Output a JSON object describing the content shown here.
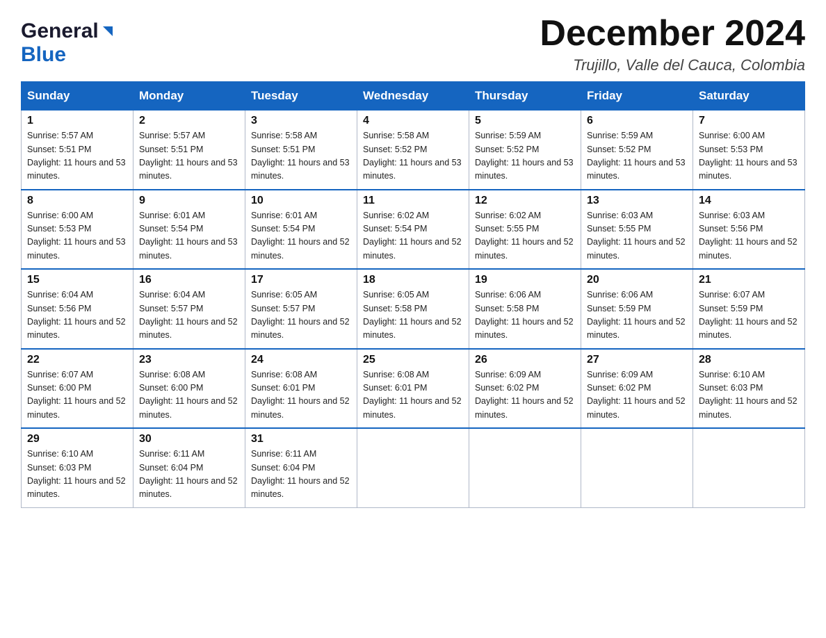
{
  "header": {
    "logo_general": "General",
    "logo_blue": "Blue",
    "month_title": "December 2024",
    "location": "Trujillo, Valle del Cauca, Colombia"
  },
  "weekdays": [
    "Sunday",
    "Monday",
    "Tuesday",
    "Wednesday",
    "Thursday",
    "Friday",
    "Saturday"
  ],
  "weeks": [
    [
      {
        "day": "1",
        "sunrise": "Sunrise: 5:57 AM",
        "sunset": "Sunset: 5:51 PM",
        "daylight": "Daylight: 11 hours and 53 minutes."
      },
      {
        "day": "2",
        "sunrise": "Sunrise: 5:57 AM",
        "sunset": "Sunset: 5:51 PM",
        "daylight": "Daylight: 11 hours and 53 minutes."
      },
      {
        "day": "3",
        "sunrise": "Sunrise: 5:58 AM",
        "sunset": "Sunset: 5:51 PM",
        "daylight": "Daylight: 11 hours and 53 minutes."
      },
      {
        "day": "4",
        "sunrise": "Sunrise: 5:58 AM",
        "sunset": "Sunset: 5:52 PM",
        "daylight": "Daylight: 11 hours and 53 minutes."
      },
      {
        "day": "5",
        "sunrise": "Sunrise: 5:59 AM",
        "sunset": "Sunset: 5:52 PM",
        "daylight": "Daylight: 11 hours and 53 minutes."
      },
      {
        "day": "6",
        "sunrise": "Sunrise: 5:59 AM",
        "sunset": "Sunset: 5:52 PM",
        "daylight": "Daylight: 11 hours and 53 minutes."
      },
      {
        "day": "7",
        "sunrise": "Sunrise: 6:00 AM",
        "sunset": "Sunset: 5:53 PM",
        "daylight": "Daylight: 11 hours and 53 minutes."
      }
    ],
    [
      {
        "day": "8",
        "sunrise": "Sunrise: 6:00 AM",
        "sunset": "Sunset: 5:53 PM",
        "daylight": "Daylight: 11 hours and 53 minutes."
      },
      {
        "day": "9",
        "sunrise": "Sunrise: 6:01 AM",
        "sunset": "Sunset: 5:54 PM",
        "daylight": "Daylight: 11 hours and 53 minutes."
      },
      {
        "day": "10",
        "sunrise": "Sunrise: 6:01 AM",
        "sunset": "Sunset: 5:54 PM",
        "daylight": "Daylight: 11 hours and 52 minutes."
      },
      {
        "day": "11",
        "sunrise": "Sunrise: 6:02 AM",
        "sunset": "Sunset: 5:54 PM",
        "daylight": "Daylight: 11 hours and 52 minutes."
      },
      {
        "day": "12",
        "sunrise": "Sunrise: 6:02 AM",
        "sunset": "Sunset: 5:55 PM",
        "daylight": "Daylight: 11 hours and 52 minutes."
      },
      {
        "day": "13",
        "sunrise": "Sunrise: 6:03 AM",
        "sunset": "Sunset: 5:55 PM",
        "daylight": "Daylight: 11 hours and 52 minutes."
      },
      {
        "day": "14",
        "sunrise": "Sunrise: 6:03 AM",
        "sunset": "Sunset: 5:56 PM",
        "daylight": "Daylight: 11 hours and 52 minutes."
      }
    ],
    [
      {
        "day": "15",
        "sunrise": "Sunrise: 6:04 AM",
        "sunset": "Sunset: 5:56 PM",
        "daylight": "Daylight: 11 hours and 52 minutes."
      },
      {
        "day": "16",
        "sunrise": "Sunrise: 6:04 AM",
        "sunset": "Sunset: 5:57 PM",
        "daylight": "Daylight: 11 hours and 52 minutes."
      },
      {
        "day": "17",
        "sunrise": "Sunrise: 6:05 AM",
        "sunset": "Sunset: 5:57 PM",
        "daylight": "Daylight: 11 hours and 52 minutes."
      },
      {
        "day": "18",
        "sunrise": "Sunrise: 6:05 AM",
        "sunset": "Sunset: 5:58 PM",
        "daylight": "Daylight: 11 hours and 52 minutes."
      },
      {
        "day": "19",
        "sunrise": "Sunrise: 6:06 AM",
        "sunset": "Sunset: 5:58 PM",
        "daylight": "Daylight: 11 hours and 52 minutes."
      },
      {
        "day": "20",
        "sunrise": "Sunrise: 6:06 AM",
        "sunset": "Sunset: 5:59 PM",
        "daylight": "Daylight: 11 hours and 52 minutes."
      },
      {
        "day": "21",
        "sunrise": "Sunrise: 6:07 AM",
        "sunset": "Sunset: 5:59 PM",
        "daylight": "Daylight: 11 hours and 52 minutes."
      }
    ],
    [
      {
        "day": "22",
        "sunrise": "Sunrise: 6:07 AM",
        "sunset": "Sunset: 6:00 PM",
        "daylight": "Daylight: 11 hours and 52 minutes."
      },
      {
        "day": "23",
        "sunrise": "Sunrise: 6:08 AM",
        "sunset": "Sunset: 6:00 PM",
        "daylight": "Daylight: 11 hours and 52 minutes."
      },
      {
        "day": "24",
        "sunrise": "Sunrise: 6:08 AM",
        "sunset": "Sunset: 6:01 PM",
        "daylight": "Daylight: 11 hours and 52 minutes."
      },
      {
        "day": "25",
        "sunrise": "Sunrise: 6:08 AM",
        "sunset": "Sunset: 6:01 PM",
        "daylight": "Daylight: 11 hours and 52 minutes."
      },
      {
        "day": "26",
        "sunrise": "Sunrise: 6:09 AM",
        "sunset": "Sunset: 6:02 PM",
        "daylight": "Daylight: 11 hours and 52 minutes."
      },
      {
        "day": "27",
        "sunrise": "Sunrise: 6:09 AM",
        "sunset": "Sunset: 6:02 PM",
        "daylight": "Daylight: 11 hours and 52 minutes."
      },
      {
        "day": "28",
        "sunrise": "Sunrise: 6:10 AM",
        "sunset": "Sunset: 6:03 PM",
        "daylight": "Daylight: 11 hours and 52 minutes."
      }
    ],
    [
      {
        "day": "29",
        "sunrise": "Sunrise: 6:10 AM",
        "sunset": "Sunset: 6:03 PM",
        "daylight": "Daylight: 11 hours and 52 minutes."
      },
      {
        "day": "30",
        "sunrise": "Sunrise: 6:11 AM",
        "sunset": "Sunset: 6:04 PM",
        "daylight": "Daylight: 11 hours and 52 minutes."
      },
      {
        "day": "31",
        "sunrise": "Sunrise: 6:11 AM",
        "sunset": "Sunset: 6:04 PM",
        "daylight": "Daylight: 11 hours and 52 minutes."
      },
      null,
      null,
      null,
      null
    ]
  ]
}
